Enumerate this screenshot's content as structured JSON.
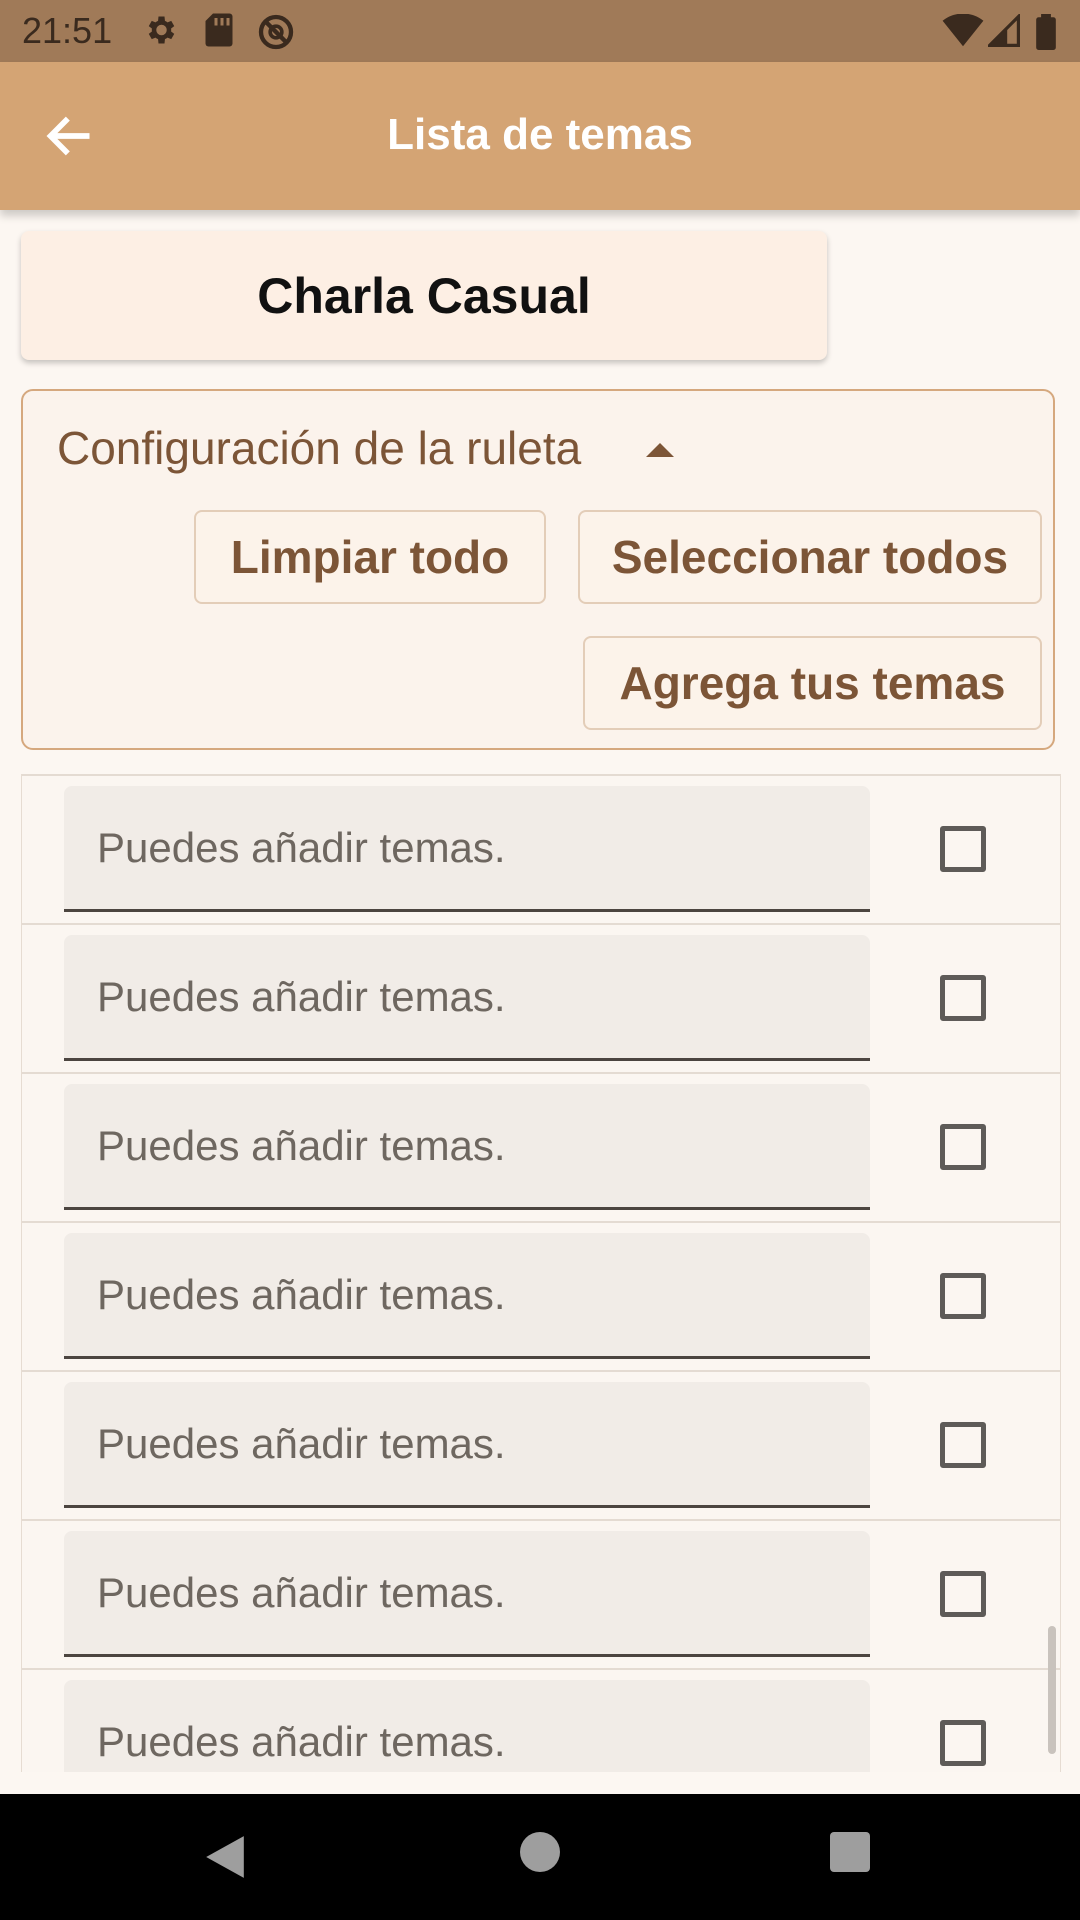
{
  "status_bar": {
    "time": "21:51",
    "left_icons": [
      "gear-icon",
      "sd-card-icon",
      "no-sync-icon"
    ],
    "right_icons": [
      "wifi-icon",
      "cell-signal-icon",
      "battery-icon"
    ]
  },
  "app_bar": {
    "title": "Lista de temas",
    "back_icon": "arrow-back-icon"
  },
  "category_card": {
    "title": "Charla Casual"
  },
  "config": {
    "title": "Configuración de la ruleta",
    "toggle_icon": "caret-up-icon",
    "clear_all_label": "Limpiar todo",
    "select_all_label": "Seleccionar todos",
    "add_topics_label": "Agrega tus temas"
  },
  "topics": {
    "placeholder": "Puedes añadir temas.",
    "items": [
      {
        "value": "",
        "checked": false
      },
      {
        "value": "",
        "checked": false
      },
      {
        "value": "",
        "checked": false
      },
      {
        "value": "",
        "checked": false
      },
      {
        "value": "",
        "checked": false
      },
      {
        "value": "",
        "checked": false
      },
      {
        "value": "",
        "checked": false
      }
    ]
  },
  "nav_bar": {
    "icons": [
      "nav-back-icon",
      "nav-home-icon",
      "nav-recents-icon"
    ]
  },
  "colors": {
    "status_bar": "#a07a58",
    "app_bar": "#d4a474",
    "accent_text": "#7c5537",
    "background": "#fcf7f2"
  }
}
